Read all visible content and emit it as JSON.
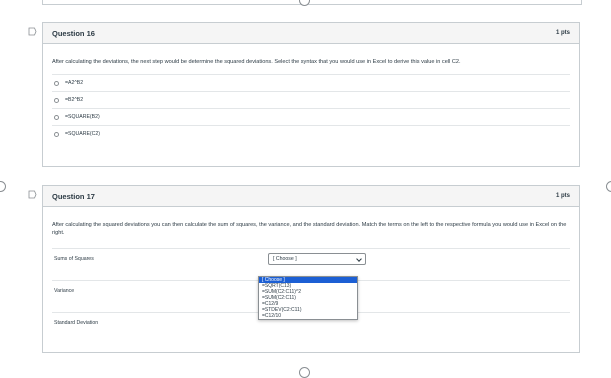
{
  "question16": {
    "title": "Question 16",
    "points": "1 pts",
    "text": "After calculating the deviations, the next step would be determine the squared deviations. Select the syntax that you would use in Excel to derive this value in cell C2.",
    "answers": [
      "=A2^B2",
      "=B2^B2",
      "=SQUARE(B2)",
      "=SQUARE(C2)"
    ]
  },
  "question17": {
    "title": "Question 17",
    "points": "1 pts",
    "text": "After calculating the squared deviations you can then calculate the sum of squares, the variance, and the standard deviation. Match the terms on the left to the respective formula you would use in Excel on the right.",
    "terms": [
      "Sums of Squares",
      "Variance",
      "Standard Deviation"
    ],
    "select_value": "[ Choose ]",
    "dropdown_options": [
      "[ Choose ]",
      "=SQRT(C13)",
      "=SUM(C2:C11)^2",
      "=SUM(C2:C11)",
      "=C12/9",
      "=STDEV(C2:C11)",
      "=C12/10"
    ],
    "selected_option_index": 0
  },
  "colors": {
    "header_bg": "#f5f5f5",
    "border": "#c7cdd1",
    "text": "#2d3b45",
    "highlight": "#1c5fd4"
  }
}
